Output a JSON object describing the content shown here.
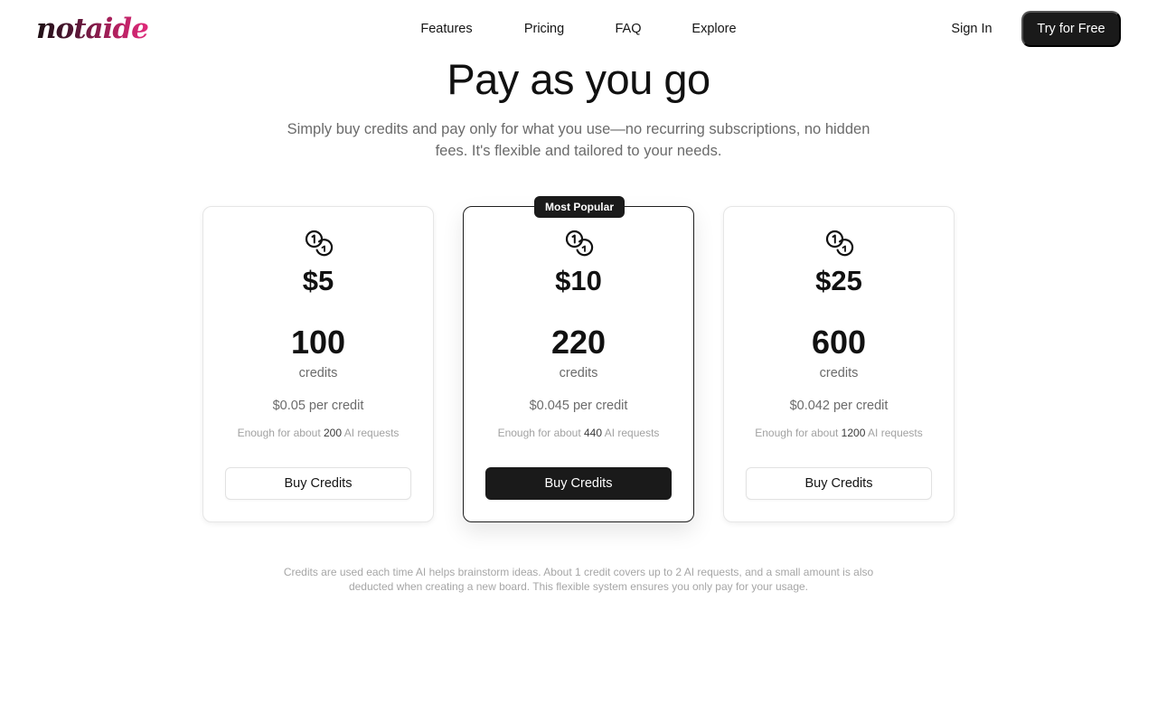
{
  "brand": {
    "logo_text": "notaide"
  },
  "nav": {
    "links": [
      "Features",
      "Pricing",
      "FAQ",
      "Explore"
    ],
    "sign_in": "Sign In",
    "cta": "Try for Free"
  },
  "hero": {
    "title": "Pay as you go",
    "subtitle": "Simply buy credits and pay only for what you use—no recurring subscriptions, no hidden fees. It's flexible and tailored to your needs."
  },
  "plans": [
    {
      "price": "$5",
      "credits": "100",
      "credits_label": "credits",
      "per_credit": "$0.05 per credit",
      "enough_prefix": "Enough for about",
      "requests": "200",
      "enough_suffix": "AI requests",
      "button": "Buy Credits"
    },
    {
      "badge": "Most Popular",
      "price": "$10",
      "credits": "220",
      "credits_label": "credits",
      "per_credit": "$0.045 per credit",
      "enough_prefix": "Enough for about",
      "requests": "440",
      "enough_suffix": "AI requests",
      "button": "Buy Credits"
    },
    {
      "price": "$25",
      "credits": "600",
      "credits_label": "credits",
      "per_credit": "$0.042 per credit",
      "enough_prefix": "Enough for about",
      "requests": "1200",
      "enough_suffix": "AI requests",
      "button": "Buy Credits"
    }
  ],
  "footnote": "Credits are used each time AI helps brainstorm ideas. About 1 credit covers up to 2 AI requests, and a small amount is also deducted when creating a new board. This flexible system ensures you only pay for your usage.",
  "icons": {
    "plan_icon": "coins-icon"
  },
  "colors": {
    "primary_dark": "#1a1a1a",
    "logo_gradient_start": "#1d1014",
    "logo_gradient_end": "#e0297a",
    "muted_text": "#6b6b6b"
  }
}
